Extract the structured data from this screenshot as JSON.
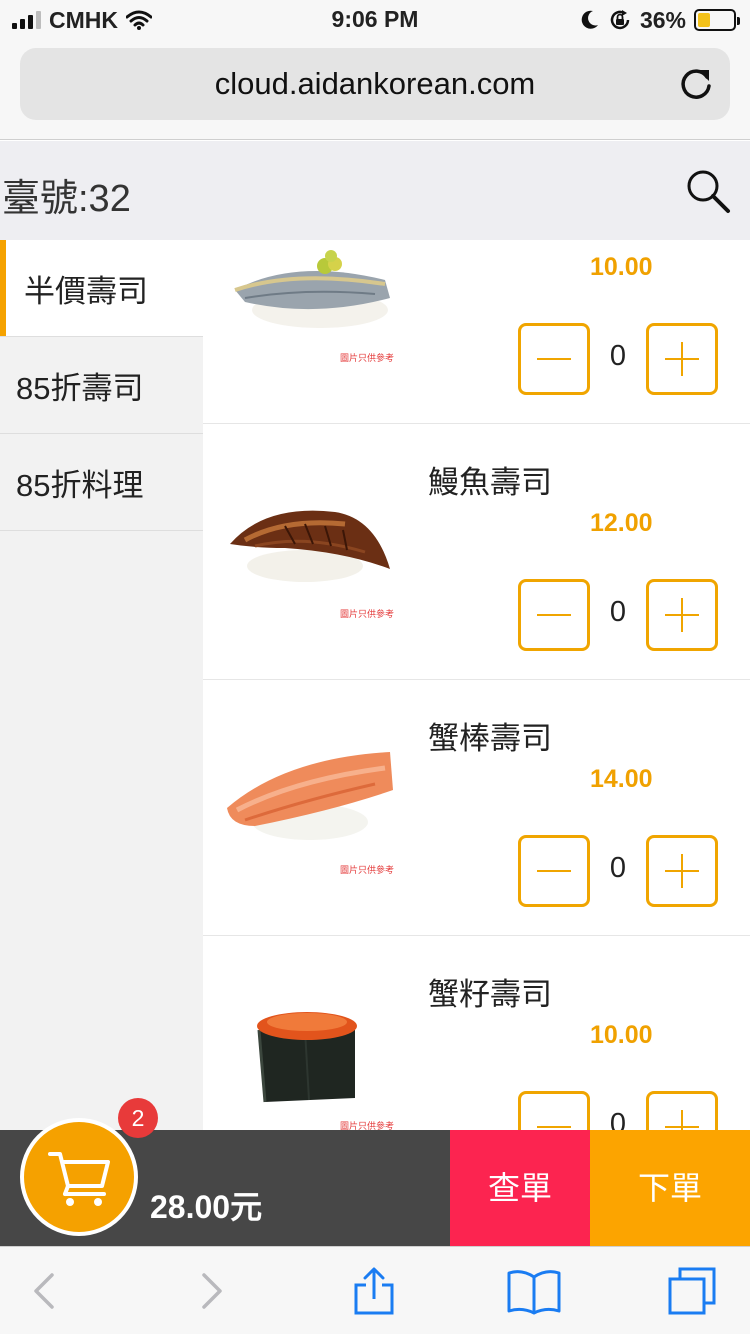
{
  "status_bar": {
    "carrier": "CMHK",
    "time": "9:06 PM",
    "battery": "36%",
    "battery_level": 0.36,
    "icons": [
      "signal-icon",
      "wifi-icon",
      "moon-icon",
      "orientation-lock-icon",
      "battery-icon"
    ]
  },
  "browser": {
    "url": "cloud.aidankorean.com",
    "toolbar_icons": [
      "back-icon",
      "forward-icon",
      "share-icon",
      "bookmarks-icon",
      "tabs-icon"
    ]
  },
  "header": {
    "table_label": "臺號:32",
    "search_icon": "search-icon"
  },
  "categories": [
    {
      "label": "半價壽司",
      "active": true
    },
    {
      "label": "85折壽司",
      "active": false
    },
    {
      "label": "85折料理",
      "active": false
    }
  ],
  "items": [
    {
      "name": "",
      "price": "10.00",
      "qty": "0",
      "image_note": "圖片只供參考",
      "image": "mackerel-sushi"
    },
    {
      "name": "鰻魚壽司",
      "price": "12.00",
      "qty": "0",
      "image_note": "圖片只供參考",
      "image": "eel-sushi"
    },
    {
      "name": "蟹棒壽司",
      "price": "14.00",
      "qty": "0",
      "image_note": "圖片只供參考",
      "image": "crab-stick-sushi"
    },
    {
      "name": "蟹籽壽司",
      "price": "10.00",
      "qty": "0",
      "image_note": "圖片只供參考",
      "image": "crab-roe-sushi"
    }
  ],
  "cart": {
    "count": "2",
    "total": "28.00元",
    "check_label": "查單",
    "order_label": "下單"
  },
  "colors": {
    "accent": "#f5a200",
    "check_button": "#fc2450",
    "order_button": "#fca400",
    "cart_bar": "#474747",
    "badge": "#e83a3a",
    "safari_blue": "#1a7cf2"
  }
}
